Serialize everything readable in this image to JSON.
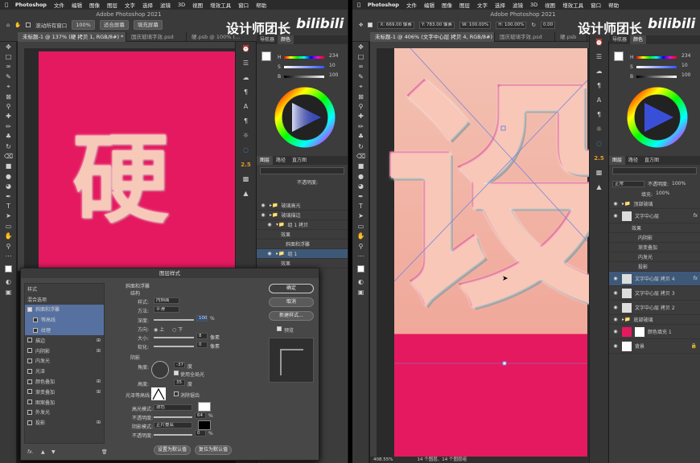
{
  "menu": {
    "app": "Photoshop",
    "items": [
      "文件",
      "编辑",
      "图像",
      "图层",
      "文字",
      "选择",
      "滤镜",
      "3D",
      "视图",
      "增效工具",
      "窗口",
      "帮助"
    ]
  },
  "watermark": {
    "text": "设计师团长",
    "brand": "bilibili"
  },
  "left": {
    "window_title": "Adobe Photoshop 2021",
    "options": {
      "scroll_all": "滚动所有窗口",
      "zoom": "100%",
      "fit_screen": "适合屏幕",
      "fill_screen": "填充屏幕"
    },
    "tabs": [
      "未标题-1 @ 137% (硬 拷贝 1, RGB/8#) *",
      "国庆玻璃字效.psd",
      "硬.psb @ 100% (…"
    ],
    "canvas_text": "硬",
    "panel_tabs": [
      "导航器",
      "颜色"
    ],
    "color_h": "234",
    "color_s": "10",
    "color_b": "100",
    "layer_tabs": [
      "图层",
      "路径",
      "直方图"
    ],
    "opacity_label": "不透明度:",
    "layers": [
      "玻璃高光",
      "玻璃描边",
      "组 1 拷贝",
      "效果",
      "斜面和浮雕",
      "组 1",
      "效果"
    ],
    "dialog": {
      "title": "图层样式",
      "left_items": [
        {
          "label": "样式",
          "check": false,
          "plus": false
        },
        {
          "label": "混合选项",
          "check": false,
          "plus": false
        },
        {
          "label": "斜面和浮雕",
          "check": true,
          "plus": false
        },
        {
          "label": "等高线",
          "check": false,
          "plus": false
        },
        {
          "label": "纹理",
          "check": false,
          "plus": false
        },
        {
          "label": "描边",
          "check": false,
          "plus": true
        },
        {
          "label": "内阴影",
          "check": false,
          "plus": true
        },
        {
          "label": "内发光",
          "check": false,
          "plus": false
        },
        {
          "label": "光泽",
          "check": false,
          "plus": false
        },
        {
          "label": "颜色叠加",
          "check": false,
          "plus": true
        },
        {
          "label": "渐变叠加",
          "check": false,
          "plus": true
        },
        {
          "label": "图案叠加",
          "check": false,
          "plus": false
        },
        {
          "label": "外发光",
          "check": false,
          "plus": false
        },
        {
          "label": "投影",
          "check": false,
          "plus": true
        }
      ],
      "section": "斜面和浮雕",
      "structure": "结构",
      "style_label": "样式:",
      "style_val": "内斜面",
      "method_label": "方法:",
      "method_val": "平滑",
      "depth_label": "深度:",
      "depth_val": "100",
      "depth_unit": "%",
      "dir_label": "方向:",
      "dir_up": "上",
      "dir_down": "下",
      "size_label": "大小:",
      "size_val": "8",
      "size_unit": "像素",
      "soften_label": "软化:",
      "soften_val": "0",
      "soften_unit": "像素",
      "shading": "阴影",
      "angle_label": "角度:",
      "angle_val": "-37",
      "angle_unit": "度",
      "global_light": "使用全局光",
      "alt_label": "高度:",
      "alt_val": "35",
      "alt_unit": "度",
      "gloss_label": "光泽等高线:",
      "antialias": "消除锯齿",
      "hl_mode_label": "高光模式:",
      "hl_mode_val": "滤色",
      "hl_op_label": "不透明度:",
      "hl_op_val": "64",
      "pct": "%",
      "sh_mode_label": "阴影模式:",
      "sh_mode_val": "正片叠底",
      "sh_op_label": "不透明度:",
      "sh_op_val": "0",
      "ok": "确定",
      "reset": "取消",
      "new_style": "新建样式...",
      "preview": "预览",
      "set_default": "设置为默认值",
      "reset_default": "复位为默认值",
      "fx": "fx."
    }
  },
  "right": {
    "window_title": "Adobe Photoshop 2021",
    "options": {
      "x": "X: 669.00 像素",
      "y": "Y: 783.00 像素",
      "w": "W: 100.00%",
      "h": "H: 100.00%",
      "angle": "0.00"
    },
    "tabs": [
      "未标题-1 @ 406% (文字中心层 拷贝 4, RGB/8#) *",
      "国庆玻璃字效.psd",
      "硬.psb"
    ],
    "canvas_text": "设",
    "status_zoom": "408.55%",
    "status_info": "14 个图层、14 个图层组",
    "panel_tabs": [
      "导航器",
      "颜色"
    ],
    "color_h": "234",
    "color_s": "10",
    "color_b": "100",
    "layer_tabs": [
      "图层",
      "路径",
      "直方图"
    ],
    "blend_mode": "正常",
    "opacity_label": "不透明度:",
    "opacity_val": "100%",
    "fill_label": "填充:",
    "fill_val": "100%",
    "layers": [
      {
        "name": "顶部玻璃",
        "indent": 0,
        "thumb": "folder"
      },
      {
        "name": "文字中心层",
        "indent": 0,
        "thumb": "text",
        "fx": true
      },
      {
        "name": "效果",
        "indent": 1,
        "thumb": ""
      },
      {
        "name": "内阴影",
        "indent": 2,
        "thumb": ""
      },
      {
        "name": "渐变叠加",
        "indent": 2,
        "thumb": ""
      },
      {
        "name": "内发光",
        "indent": 2,
        "thumb": ""
      },
      {
        "name": "投影",
        "indent": 2,
        "thumb": ""
      },
      {
        "name": "文字中心层 拷贝 4",
        "indent": 0,
        "thumb": "text",
        "selected": true,
        "fx": true
      },
      {
        "name": "文字中心层 拷贝 3",
        "indent": 0,
        "thumb": "text"
      },
      {
        "name": "文字中心层 拷贝 2",
        "indent": 0,
        "thumb": "text"
      },
      {
        "name": "底部玻璃",
        "indent": 0,
        "thumb": "folder"
      },
      {
        "name": "颜色填充 1",
        "indent": 0,
        "thumb": "fill"
      },
      {
        "name": "背景",
        "indent": 0,
        "thumb": "white"
      }
    ]
  },
  "colors": {
    "canvas_magenta": "#e5195f",
    "peach": "#f6c9b8",
    "panel": "#3c3c3c",
    "selected_layer": "#3e5878"
  }
}
